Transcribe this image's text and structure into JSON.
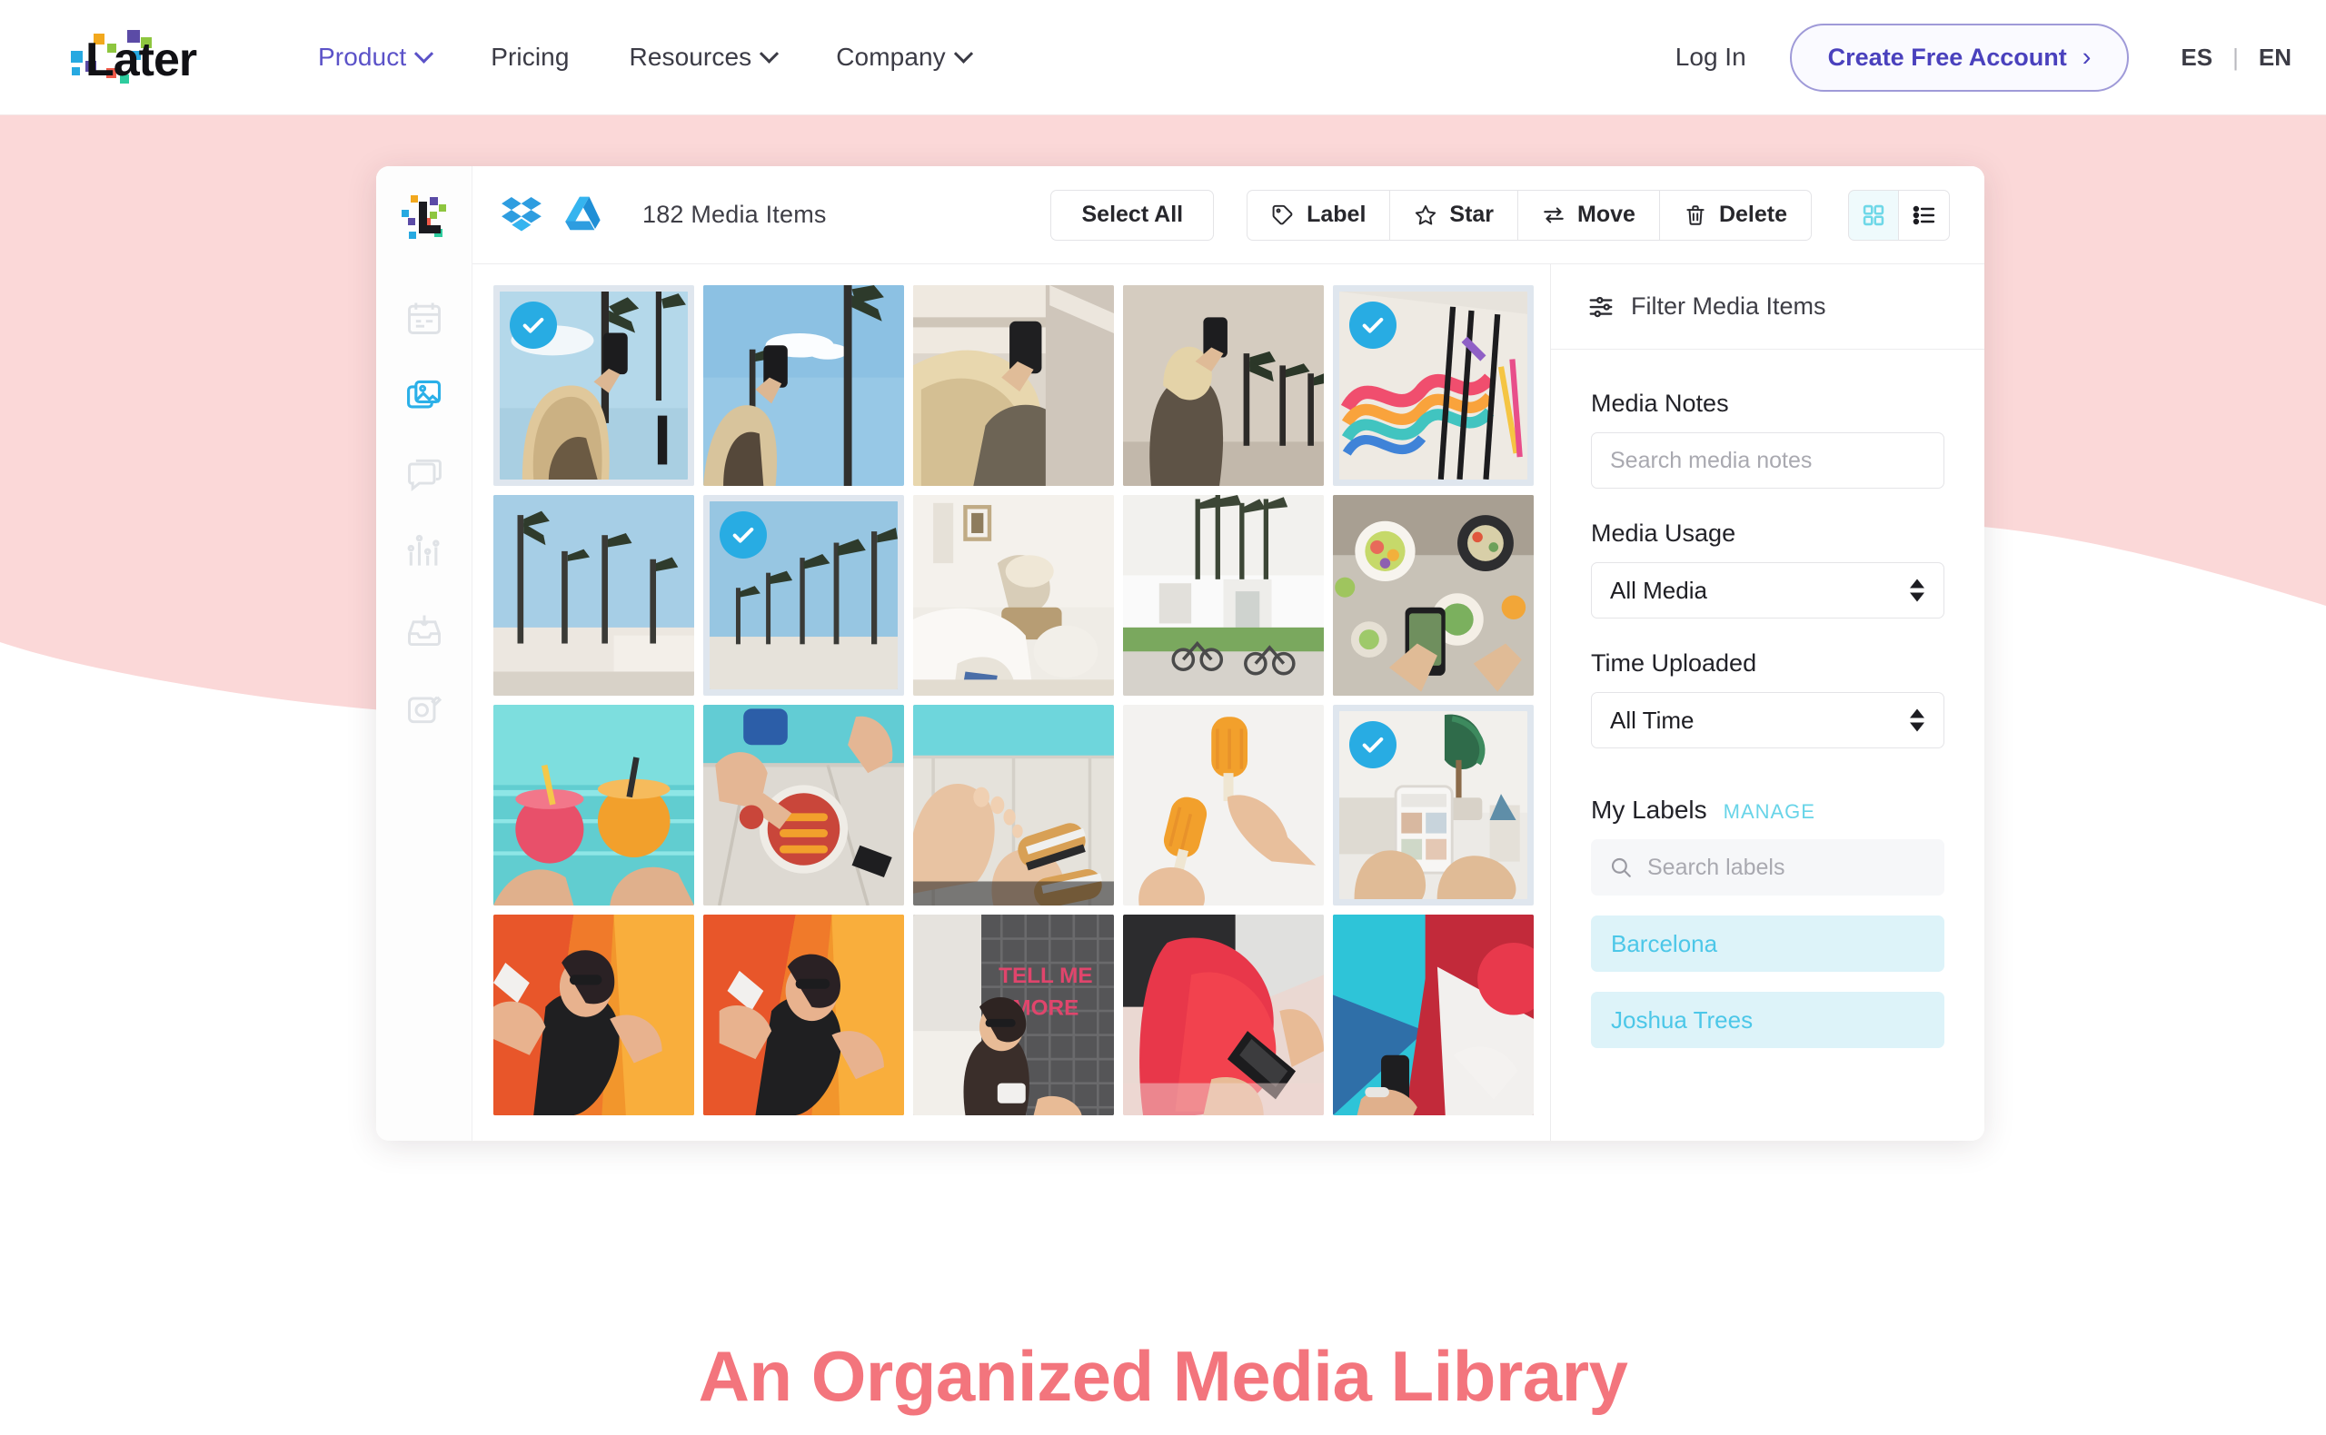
{
  "nav": {
    "logo_text": "Later",
    "links": [
      {
        "label": "Product",
        "has_dropdown": true,
        "active": true
      },
      {
        "label": "Pricing",
        "has_dropdown": false,
        "active": false
      },
      {
        "label": "Resources",
        "has_dropdown": true,
        "active": false
      },
      {
        "label": "Company",
        "has_dropdown": true,
        "active": false
      }
    ],
    "login_label": "Log In",
    "cta_label": "Create Free Account",
    "cta_arrow": "›",
    "lang_primary": "ES",
    "lang_separator": "|",
    "lang_secondary": "EN",
    "accent_purple": "#5b52c8"
  },
  "hero": {
    "background_pink": "#fbd8d8",
    "section_title": "An Organized Media Library",
    "section_title_color": "#f3757d"
  },
  "app": {
    "rail": {
      "icons": [
        {
          "name": "calendar-icon",
          "active": false
        },
        {
          "name": "media-library-icon",
          "active": true
        },
        {
          "name": "conversations-icon",
          "active": false
        },
        {
          "name": "analytics-icon",
          "active": false
        },
        {
          "name": "inbox-download-icon",
          "active": false
        },
        {
          "name": "link-in-bio-icon",
          "active": false
        }
      ],
      "active_color": "#2bb0e8",
      "inactive_color": "#dfe2e6"
    },
    "toolbar": {
      "cloud_sources": [
        "dropbox-icon",
        "google-drive-icon"
      ],
      "media_count_text": "182 Media Items",
      "select_all_label": "Select All",
      "actions": [
        {
          "label": "Label",
          "icon": "tag-icon"
        },
        {
          "label": "Star",
          "icon": "star-icon"
        },
        {
          "label": "Move",
          "icon": "move-arrows-icon"
        },
        {
          "label": "Delete",
          "icon": "trash-icon"
        }
      ],
      "views": [
        {
          "name": "grid-view-toggle",
          "active": true
        },
        {
          "name": "list-view-toggle",
          "active": false
        }
      ],
      "active_view_color": "#6fd8e8"
    },
    "grid": {
      "columns": 5,
      "selected_color": "#28ace3",
      "cells": [
        {
          "id": "r1c1",
          "selected": true,
          "desc": "woman-photographing-palm-trees"
        },
        {
          "id": "r1c2",
          "selected": false,
          "desc": "phone-held-up-to-sky-palms"
        },
        {
          "id": "r1c3",
          "selected": false,
          "desc": "blonde-woman-holding-phone"
        },
        {
          "id": "r1c4",
          "selected": false,
          "desc": "woman-back-facing-palm-wall"
        },
        {
          "id": "r1c5",
          "selected": true,
          "desc": "colorful-rainbow-mural"
        },
        {
          "id": "r2c1",
          "selected": false,
          "desc": "palm-trees-white-building"
        },
        {
          "id": "r2c2",
          "selected": true,
          "desc": "palm-tree-row-blue-sky"
        },
        {
          "id": "r2c3",
          "selected": false,
          "desc": "white-bedroom-interior"
        },
        {
          "id": "r2c4",
          "selected": false,
          "desc": "modern-house-bicycles"
        },
        {
          "id": "r2c5",
          "selected": false,
          "desc": "flatlay-food-bowls-phone"
        },
        {
          "id": "r3c1",
          "selected": false,
          "desc": "poolside-cocktails-cheers"
        },
        {
          "id": "r3c2",
          "selected": false,
          "desc": "poolside-food-platter"
        },
        {
          "id": "r3c3",
          "selected": false,
          "desc": "feet-sandals-by-pool"
        },
        {
          "id": "r3c4",
          "selected": false,
          "desc": "orange-popsicles-hands"
        },
        {
          "id": "r3c5",
          "selected": true,
          "desc": "hands-holding-phone-sofa"
        },
        {
          "id": "r4c1",
          "selected": false,
          "desc": "selfie-orange-wall"
        },
        {
          "id": "r4c2",
          "selected": false,
          "desc": "selfie-orange-wall-sunglasses"
        },
        {
          "id": "r4c3",
          "selected": false,
          "desc": "woman-brick-wall-sign"
        },
        {
          "id": "r4c4",
          "selected": false,
          "desc": "red-outfit-phone-in-hand"
        },
        {
          "id": "r4c5",
          "selected": false,
          "desc": "geometric-mural-phone"
        }
      ]
    },
    "filters": {
      "header": "Filter Media Items",
      "media_notes_label": "Media Notes",
      "media_notes_placeholder": "Search media notes",
      "media_notes_value": "",
      "media_usage_label": "Media Usage",
      "media_usage_value": "All Media",
      "media_usage_options": [
        "All Media"
      ],
      "time_uploaded_label": "Time Uploaded",
      "time_uploaded_value": "All Time",
      "time_uploaded_options": [
        "All Time"
      ],
      "labels_title": "My Labels",
      "manage_label": "MANAGE",
      "label_search_placeholder": "Search labels",
      "label_search_value": "",
      "labels": [
        {
          "name": "Barcelona"
        },
        {
          "name": "Joshua Trees"
        }
      ],
      "label_chip_color": "#4cc7e8"
    }
  }
}
